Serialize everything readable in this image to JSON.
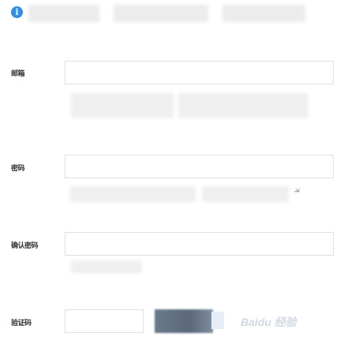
{
  "notice": {
    "icon": "info-icon",
    "text": ""
  },
  "form": {
    "fields": [
      {
        "label": "邮箱",
        "value": "",
        "placeholder": ""
      },
      {
        "label": "密码",
        "value": "",
        "placeholder": ""
      },
      {
        "label": "确认密码",
        "value": "",
        "placeholder": ""
      },
      {
        "label": "验证码",
        "value": "",
        "placeholder": ""
      }
    ]
  },
  "side_glyph": "ʞ",
  "watermark": "Baidu 经验",
  "colors": {
    "info_blue": "#2f8ee6",
    "border": "#e0e0e0",
    "label_text": "#333333"
  }
}
